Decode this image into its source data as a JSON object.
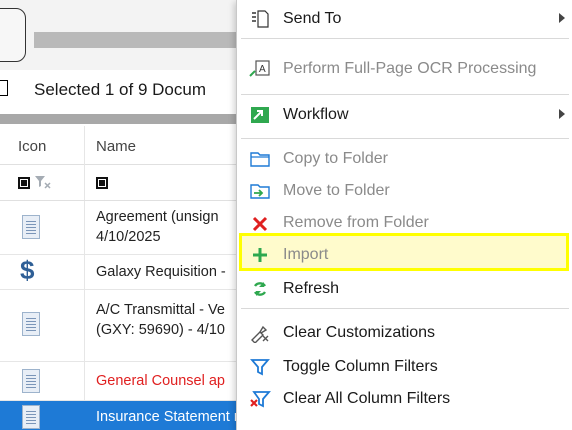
{
  "list": {
    "selection_text": "Selected 1 of 9 Docum",
    "columns": {
      "icon": "Icon",
      "name": "Name"
    },
    "rows": [
      {
        "line1": "Agreement (unsign",
        "line2": "4/10/2025",
        "icon": "document-icon",
        "color": "#222222",
        "selected": false
      },
      {
        "line1": "Galaxy Requisition -",
        "line2": "",
        "icon": "dollar-icon",
        "color": "#222222",
        "selected": false
      },
      {
        "line1": "A/C Transmittal - Ve",
        "line2": "(GXY: 59690) - 4/10",
        "icon": "pen-document-icon",
        "color": "#222222",
        "selected": false
      },
      {
        "line1": "General Counsel ap",
        "line2": "",
        "icon": "document-search-icon",
        "color": "#e02020",
        "selected": false
      },
      {
        "line1": "Insurance Statement missing",
        "line2": "",
        "icon": "document-search-icon",
        "color": "#ffffff",
        "selected": true
      }
    ]
  },
  "menu": {
    "items": [
      {
        "label": "Send To",
        "icon": "send-to-icon",
        "submenu": true,
        "enabled": true
      },
      {
        "label": "Perform Full-Page OCR Processing",
        "icon": "ocr-icon",
        "submenu": false,
        "enabled": false
      },
      {
        "label": "Workflow",
        "icon": "workflow-icon",
        "submenu": true,
        "enabled": true
      },
      {
        "label": "Copy to Folder",
        "icon": "folder-copy-icon",
        "submenu": false,
        "enabled": false
      },
      {
        "label": "Move to Folder",
        "icon": "folder-move-icon",
        "submenu": false,
        "enabled": false
      },
      {
        "label": "Remove from Folder",
        "icon": "remove-icon",
        "submenu": false,
        "enabled": false
      },
      {
        "label": "Import",
        "icon": "plus-icon",
        "submenu": false,
        "enabled": false,
        "highlighted": true
      },
      {
        "label": "Refresh",
        "icon": "refresh-icon",
        "submenu": false,
        "enabled": true
      },
      {
        "label": "Clear Customizations",
        "icon": "clear-customizations-icon",
        "submenu": false,
        "enabled": true
      },
      {
        "label": "Toggle Column Filters",
        "icon": "filter-icon",
        "submenu": false,
        "enabled": true
      },
      {
        "label": "Clear All Column Filters",
        "icon": "clear-filter-icon",
        "submenu": false,
        "enabled": true
      }
    ]
  },
  "colors": {
    "highlight_border": "#ffff00",
    "selection_blue": "#1e7ad6",
    "red_text": "#e02020",
    "disabled_text": "#8a8a8a"
  }
}
